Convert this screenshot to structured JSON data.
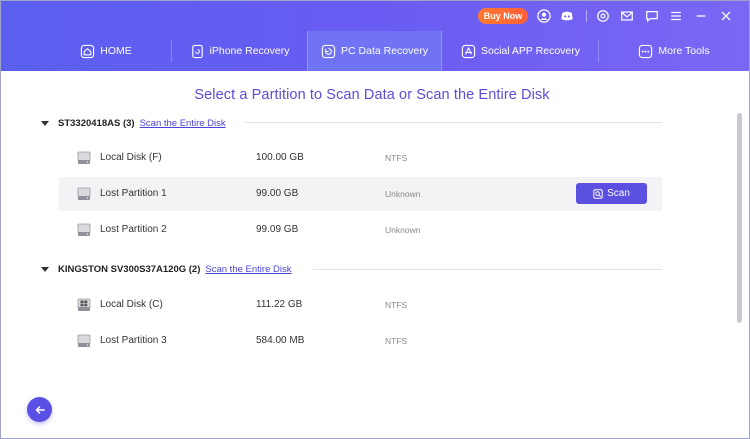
{
  "titlebar": {
    "buy_now_label": "Buy Now",
    "icons": [
      "user-icon",
      "discord-icon",
      "target-icon",
      "mail-icon",
      "chat-icon",
      "menu-icon",
      "minimize-icon",
      "close-icon"
    ]
  },
  "tabs": [
    {
      "label": "HOME",
      "icon": "home-icon"
    },
    {
      "label": "iPhone Recovery",
      "icon": "phone-icon"
    },
    {
      "label": "PC Data Recovery",
      "icon": "restore-icon"
    },
    {
      "label": "Social APP Recovery",
      "icon": "app-store-icon"
    },
    {
      "label": "More Tools",
      "icon": "more-tools-icon"
    }
  ],
  "active_tab": "PC Data Recovery",
  "page": {
    "title": "Select a Partition to Scan Data or Scan the Entire Disk"
  },
  "disks": [
    {
      "name": "ST3320418AS (3)",
      "scan_entire_label": "Scan the Entire Disk",
      "partitions": [
        {
          "name": "Local Disk (F)",
          "size": "100.00 GB",
          "fs": "NTFS",
          "icon": "disk-icon"
        },
        {
          "name": "Lost Partition 1",
          "size": "99.00 GB",
          "fs": "Unknown",
          "icon": "disk-icon",
          "selected": true
        },
        {
          "name": "Lost Partition 2",
          "size": "99.09 GB",
          "fs": "Unknown",
          "icon": "disk-icon"
        }
      ]
    },
    {
      "name": "KINGSTON SV300S37A120G (2)",
      "scan_entire_label": "Scan the Entire Disk",
      "partitions": [
        {
          "name": "Local Disk (C)",
          "size": "111.22 GB",
          "fs": "NTFS",
          "icon": "windows-disk-icon"
        },
        {
          "name": "Lost Partition 3",
          "size": "584.00 MB",
          "fs": "NTFS",
          "icon": "disk-icon"
        }
      ]
    }
  ],
  "scan_button_label": "Scan",
  "colors": {
    "header_start": "#5a5ff0",
    "header_end": "#7a68f4",
    "accent": "#5b50e0",
    "buy_now": "#ff6a35"
  }
}
